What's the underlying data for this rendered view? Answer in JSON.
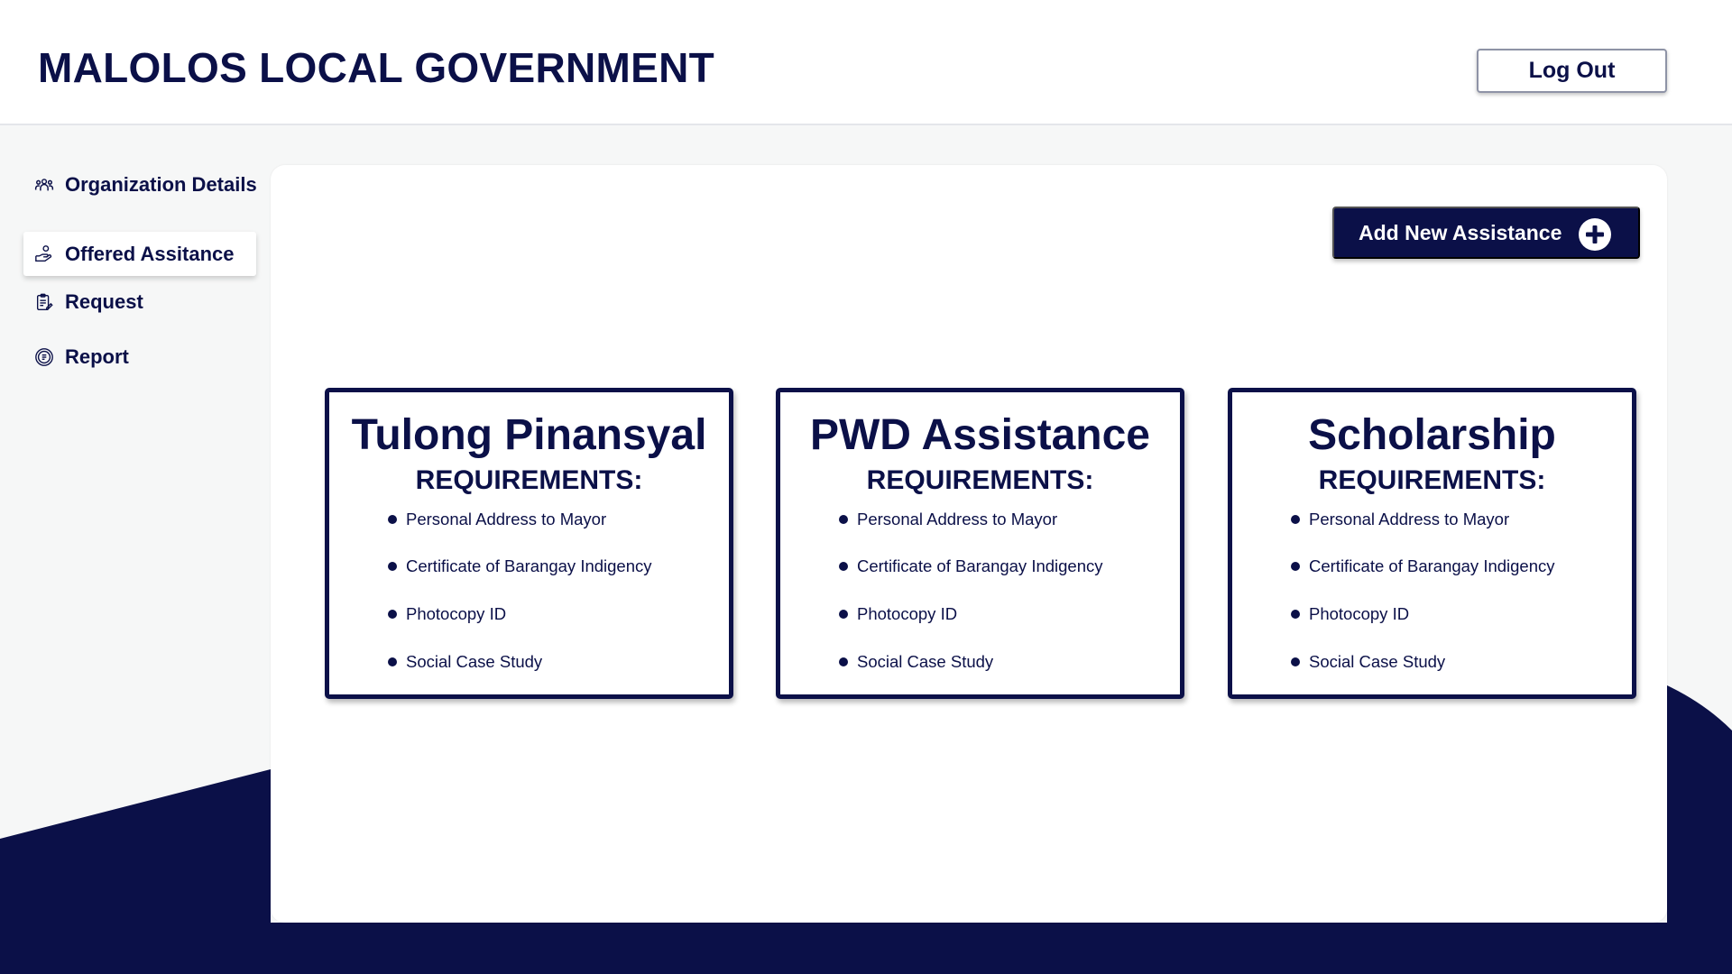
{
  "header": {
    "title": "MALOLOS LOCAL GOVERNMENT",
    "logout_label": "Log Out"
  },
  "sidebar": {
    "items": [
      {
        "label": "Organization Details",
        "icon": "people-group-icon"
      },
      {
        "label": "Offered Assitance",
        "icon": "hand-coins-icon",
        "active": true
      },
      {
        "label": "Request",
        "icon": "clipboard-edit-icon"
      },
      {
        "label": "Report",
        "icon": "report-badge-icon"
      }
    ]
  },
  "main": {
    "add_button_label": "Add New Assistance",
    "requirements_heading": "REQUIREMENTS:",
    "cards": [
      {
        "title": "Tulong Pinansyal",
        "requirements": [
          "Personal Address to Mayor",
          "Certificate of Barangay Indigency",
          "Photocopy ID",
          "Social Case Study"
        ]
      },
      {
        "title": "PWD Assistance",
        "requirements": [
          "Personal Address to Mayor",
          "Certificate of Barangay Indigency",
          "Photocopy ID",
          "Social Case Study"
        ]
      },
      {
        "title": "Scholarship",
        "requirements": [
          "Personal Address to Mayor",
          "Certificate of Barangay Indigency",
          "Photocopy ID",
          "Social Case Study"
        ]
      }
    ]
  },
  "colors": {
    "primary_navy": "#0b1048",
    "background": "#f6f7f7",
    "card_bg": "#ffffff"
  }
}
